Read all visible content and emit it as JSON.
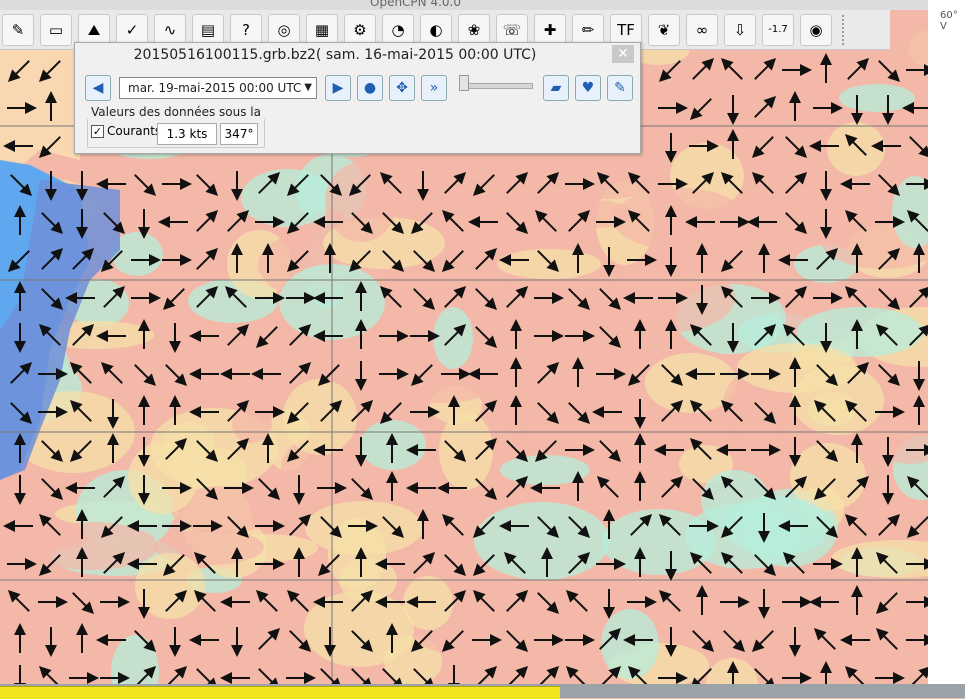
{
  "app": {
    "title": "OpenCPN 4.0.0"
  },
  "toolbar": {
    "items": [
      {
        "name": "route-icon",
        "glyph": "✎"
      },
      {
        "name": "chart-icon",
        "glyph": "▭"
      },
      {
        "name": "tide-icon",
        "glyph": "⛰"
      },
      {
        "name": "track-icon",
        "glyph": "✓"
      },
      {
        "name": "route-manager-icon",
        "glyph": "∿"
      },
      {
        "name": "sunset-icon",
        "glyph": "▤"
      },
      {
        "name": "help-icon",
        "glyph": "?"
      },
      {
        "name": "radar-icon",
        "glyph": "◎"
      },
      {
        "name": "map-icon",
        "glyph": "▦"
      },
      {
        "name": "settings-icon",
        "glyph": "⚙"
      },
      {
        "name": "gezar-icon",
        "glyph": "◔"
      },
      {
        "name": "earth-icon",
        "glyph": "◐"
      },
      {
        "name": "grib-icon",
        "glyph": "❀"
      },
      {
        "name": "ais-icon",
        "glyph": "☏"
      },
      {
        "name": "compass-icon",
        "glyph": "✚"
      },
      {
        "name": "pencil-icon",
        "glyph": "✏"
      },
      {
        "name": "tf-icon",
        "glyph": "TF"
      },
      {
        "name": "dog-icon",
        "glyph": "❦"
      },
      {
        "name": "binoculars-icon",
        "glyph": "∞"
      },
      {
        "name": "download-icon",
        "glyph": "⇩"
      },
      {
        "name": "zoom-icon",
        "glyph": "-1.7"
      },
      {
        "name": "lifebuoy-icon",
        "glyph": "◉"
      }
    ]
  },
  "map": {
    "latitude_label": "60° V"
  },
  "grib_dialog": {
    "title": "20150516100115.grb.bz2( sam. 16-mai-2015 00:00  UTC)",
    "close_glyph": "✕",
    "selected_date": "mar. 19-mai-2015 00:00  UTC",
    "prev_glyph": "◀",
    "next_glyph": "▶",
    "values_label": "Valeurs des données sous la sou",
    "courants_checked": "✓",
    "courants_label": "Courants",
    "speed_value": "1.3 kts",
    "direction_value": "347°"
  },
  "colors": {
    "sea_warm": "#f3b8a8",
    "sea_mid": "#f6e0a8",
    "sea_cool": "#b7eedb",
    "land": "#f8d7b1",
    "deep_blue": "#6f8fd8",
    "shore_blue": "#5fa8f0"
  }
}
